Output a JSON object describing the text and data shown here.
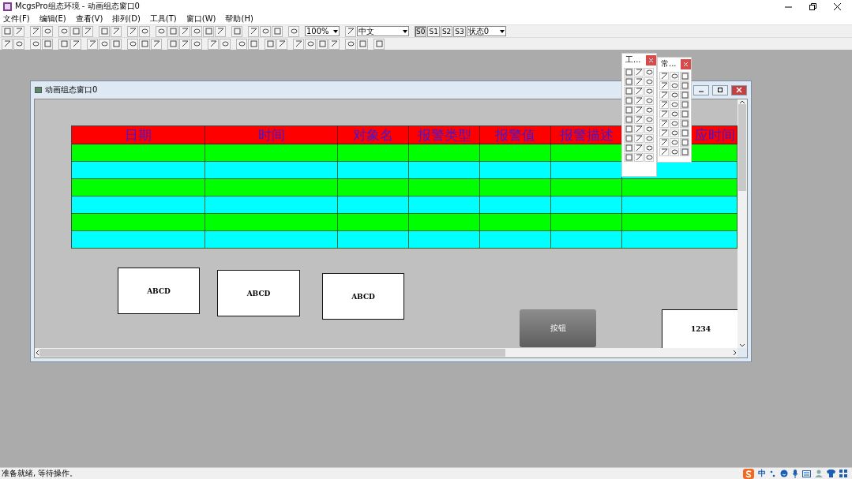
{
  "window": {
    "title": "McgsPro组态环境 - 动画组态窗口0"
  },
  "menu": [
    "文件(F)",
    "编辑(E)",
    "查看(V)",
    "排列(D)",
    "工具(T)",
    "窗口(W)",
    "帮助(H)"
  ],
  "toolbar": {
    "zoom": "100%",
    "font": "中文",
    "state": "状态0",
    "state_buttons": [
      {
        "label": "S0",
        "selected": true
      },
      {
        "label": "S1",
        "selected": false
      },
      {
        "label": "S2",
        "selected": false
      },
      {
        "label": "S3",
        "selected": false
      }
    ]
  },
  "child_window": {
    "title": "动画组态窗口0",
    "table": {
      "columns": [
        "日期",
        "时间",
        "对象名",
        "报警类型",
        "报警值",
        "报警描述",
        "应时间"
      ],
      "rows": [
        {
          "color": "#00ff00"
        },
        {
          "color": "#00ffff"
        },
        {
          "color": "#00ff00"
        },
        {
          "color": "#00ffff"
        },
        {
          "color": "#00ff00"
        },
        {
          "color": "#00ffff"
        }
      ]
    },
    "widgets": [
      {
        "kind": "label",
        "text": "ABCD"
      },
      {
        "kind": "label",
        "text": "ABCD"
      },
      {
        "kind": "label",
        "text": "ABCD"
      },
      {
        "kind": "button",
        "text": "按钮"
      },
      {
        "kind": "label",
        "text": "1234"
      }
    ]
  },
  "toolboxes": [
    {
      "title": "工..."
    },
    {
      "title": "常..."
    }
  ],
  "status_bar": {
    "text": "准备就绪, 等待操作。",
    "ime": "中"
  }
}
